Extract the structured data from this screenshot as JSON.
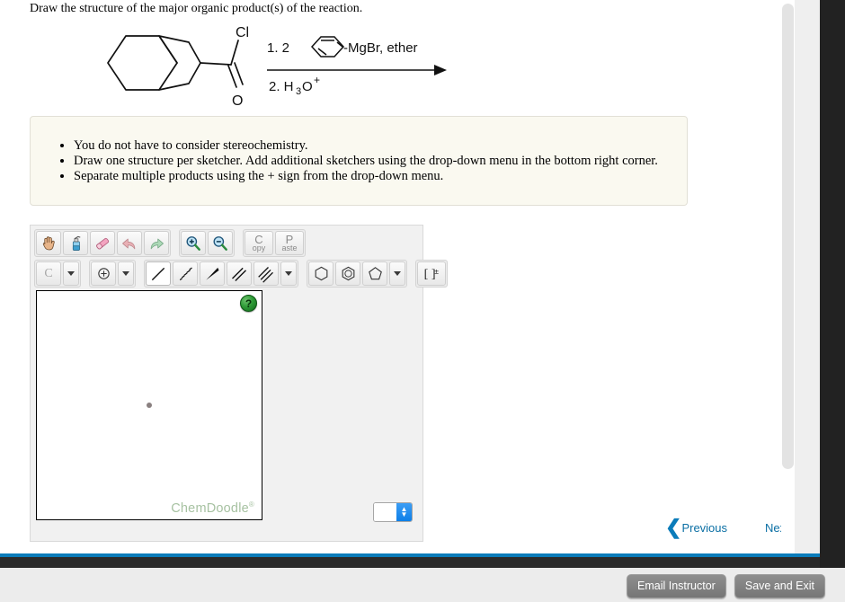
{
  "prompt": "Draw the structure of the major organic product(s) of the reaction.",
  "reaction": {
    "reactant_label": "acyl chloride on bicyclo[4.3.0] (hydrindane) ring",
    "reactant_atoms": {
      "chlorine": "Cl",
      "oxygen": "O"
    },
    "reagent_line_1": "1.  2",
    "reagent_line_1_suffix": "-MgBr, ether",
    "reagent_line_2": "2. H",
    "reagent_line_2_sub": "3",
    "reagent_line_2_rest": "O",
    "reagent_line_2_sup": "+"
  },
  "instructions": {
    "items": [
      "You do not have to consider stereochemistry.",
      "Draw one structure per sketcher. Add additional sketchers using the drop-down menu in the bottom right corner.",
      "Separate multiple products using the + sign from the drop-down menu."
    ]
  },
  "sketcher": {
    "toolbar_row1": [
      {
        "name": "pan-hand-icon",
        "title": "Pan"
      },
      {
        "name": "clear-bottle-icon",
        "title": "Clear"
      },
      {
        "name": "eraser-icon",
        "title": "Erase"
      },
      {
        "name": "undo-icon",
        "title": "Undo"
      },
      {
        "name": "redo-icon",
        "title": "Redo"
      },
      {
        "name": "zoom-in-icon",
        "title": "Zoom In"
      },
      {
        "name": "zoom-out-icon",
        "title": "Zoom Out"
      }
    ],
    "copy_label_big": "C",
    "copy_label_small": "opy",
    "paste_label_big": "P",
    "paste_label_small": "aste",
    "element_label": "C",
    "charge_label": "+",
    "bond_tools": [
      {
        "name": "single-bond-icon",
        "selected": true
      },
      {
        "name": "hashed-wedge-bond-icon",
        "selected": false
      },
      {
        "name": "solid-wedge-bond-icon",
        "selected": false
      },
      {
        "name": "double-bond-icon",
        "selected": false
      },
      {
        "name": "triple-bond-icon",
        "selected": false
      }
    ],
    "ring_tools": [
      {
        "name": "cyclohexane-ring-icon"
      },
      {
        "name": "benzene-ring-icon"
      },
      {
        "name": "cyclopentane-ring-icon"
      }
    ],
    "bracket_tool_label": "[ ]",
    "bracket_tool_charge": "±",
    "canvas": {
      "help_badge": "?",
      "watermark": "ChemDoodle",
      "watermark_mark": "®"
    },
    "sketcher_count_value": ""
  },
  "navigation": {
    "previous_label": "Previous",
    "next_label": "Next",
    "previous_chevron": "❮",
    "next_chevron": "❯"
  },
  "footer": {
    "email_instructor_label": "Email Instructor",
    "save_and_exit_label": "Save and Exit"
  },
  "colors": {
    "accent_blue": "#0b7cba",
    "callout_bg": "#faf9f0",
    "panel_bg": "#f1f1f1",
    "footer_bg": "#ececec",
    "dark_bar": "#2b2b2b",
    "watermark_green": "#a7c2a2"
  }
}
